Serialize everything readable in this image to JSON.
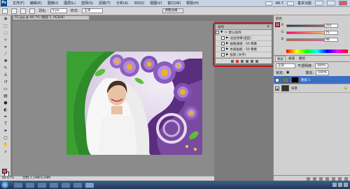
{
  "menu": {
    "logo": "Ps",
    "items": [
      "文件(F)",
      "编辑(E)",
      "图像(I)",
      "图层(L)",
      "选择(S)",
      "滤镜(T)",
      "分析(A)",
      "3D(D)",
      "视图(V)",
      "窗口(W)",
      "帮助(H)"
    ],
    "zoom": "66.7",
    "workspace": "基本功能"
  },
  "options": {
    "feather_label": "羽化:",
    "feather_value": "0 px",
    "style_label": "样式:",
    "style_value": "正常",
    "refine_edge": "调整边缘..."
  },
  "document": {
    "tab_title": "01.jpg @ 66.7% (图层 1, RGB/8)",
    "zoom_status": "66.67%",
    "doc_size": "文档:1.19M/3.29M"
  },
  "actions": {
    "title": "动作",
    "set_name": "默认动作",
    "items": [
      "淡出效果(选区)",
      "画框通道 - 50 像素",
      "木质画框 - 50 像素",
      "投影 (文字)"
    ]
  },
  "color": {
    "tab": "颜色",
    "r_label": "R",
    "g_label": "G",
    "b_label": "B",
    "r": "255",
    "g": "75",
    "b": "98",
    "r_frac": 1.0,
    "g_frac": 0.29,
    "b_frac": 0.38,
    "fg_color": "#e6536a"
  },
  "layers": {
    "tabs": [
      "图层",
      "通道",
      "路径"
    ],
    "blend_mode": "正常",
    "opacity_label": "不透明度:",
    "opacity": "100%",
    "lock_label": "锁定:",
    "fill_label": "填充:",
    "fill": "100%",
    "items": [
      {
        "name": "图层 1",
        "selected": true
      },
      {
        "name": "背景",
        "selected": false
      }
    ]
  },
  "accent": "#c01818"
}
